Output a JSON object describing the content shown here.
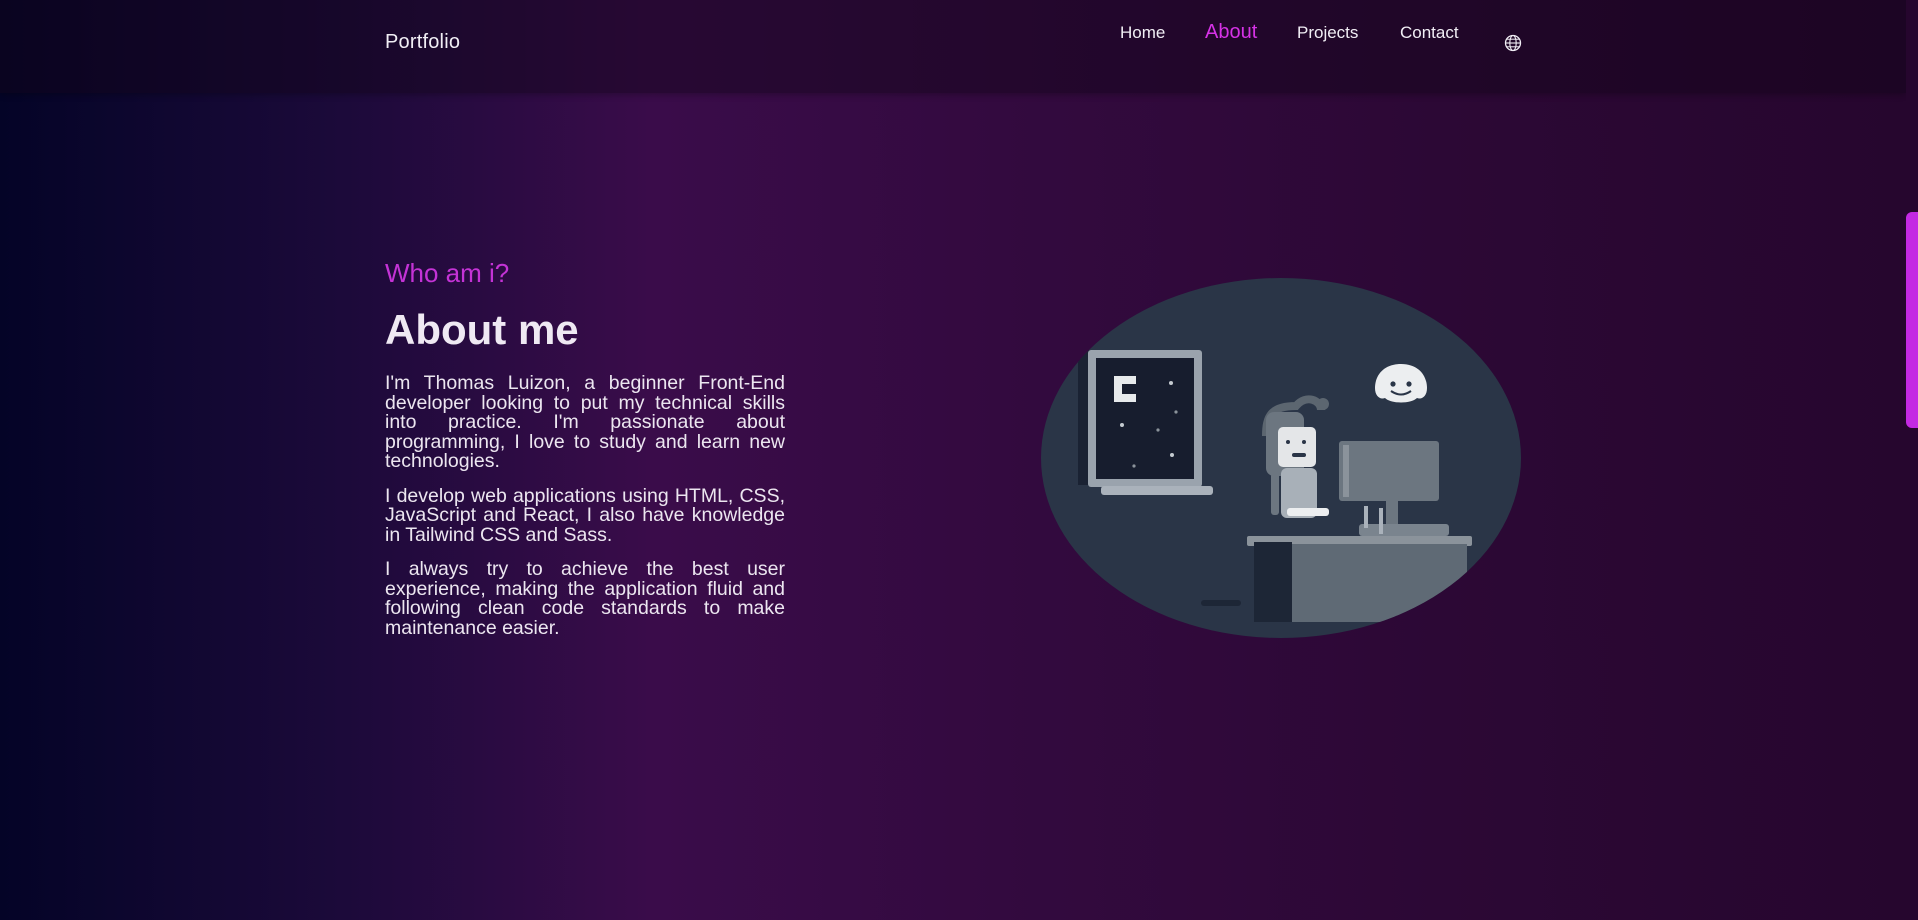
{
  "nav": {
    "brand": "Portfolio",
    "links": [
      {
        "label": "Home"
      },
      {
        "label": "About"
      },
      {
        "label": "Projects"
      },
      {
        "label": "Contact"
      }
    ],
    "language_icon": "globe-icon"
  },
  "about": {
    "subtitle": "Who am i?",
    "heading": "About me",
    "paragraphs": [
      "I'm Thomas Luizon, a beginner Front-End developer looking to put my technical skills into practice. I'm passionate about programming, I love to study and learn new technologies.",
      "I develop web applications using HTML, CSS, JavaScript and React, I also have knowledge in Tailwind CSS and Sass.",
      "I always try to achieve the best user experience, making the application fluid and following clean code standards to make maintenance easier."
    ]
  },
  "illustration": "person-at-computer-illustration",
  "colors": {
    "accent": "#d632e6",
    "subtitle": "#c433d6",
    "scrollbar": "#c429e3",
    "illustration_bg": "#2a3547"
  }
}
